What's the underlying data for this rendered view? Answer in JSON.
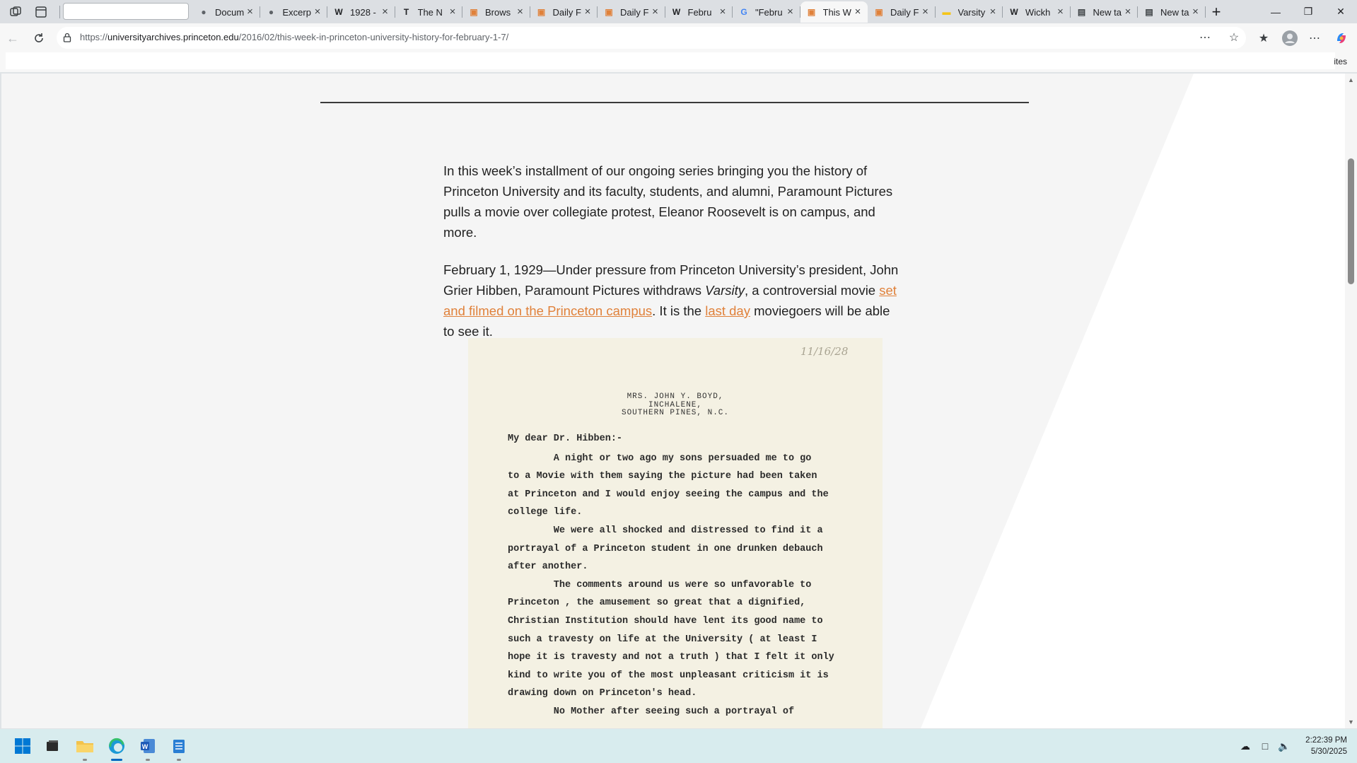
{
  "browser": {
    "tabs": [
      {
        "label": "Docum",
        "icon": "website-icon"
      },
      {
        "label": "Excerp",
        "icon": "website-icon"
      },
      {
        "label": "1928 -",
        "icon": "wikipedia-icon"
      },
      {
        "label": "The N",
        "icon": "nyt-icon"
      },
      {
        "label": "Brows",
        "icon": "blog-icon"
      },
      {
        "label": "Daily F",
        "icon": "blog-icon"
      },
      {
        "label": "Daily F",
        "icon": "blog-icon"
      },
      {
        "label": "Febru",
        "icon": "wikipedia-icon"
      },
      {
        "label": "\"Febru",
        "icon": "google-icon"
      },
      {
        "label": "This W",
        "icon": "blog-icon",
        "active": true
      },
      {
        "label": "Daily F",
        "icon": "blog-icon"
      },
      {
        "label": "Varsity",
        "icon": "imdb-icon"
      },
      {
        "label": "Wickh",
        "icon": "wikipedia-icon"
      },
      {
        "label": "New ta",
        "icon": "newtab-icon"
      },
      {
        "label": "New ta",
        "icon": "newtab-icon"
      }
    ],
    "url_domain": "universityarchives.princeton.edu",
    "url_path": "/2016/02/this-week-in-princeton-university-history-for-february-1-7/",
    "scheme": "https://",
    "favorites_label": "ites",
    "accent_color": "#0067c0"
  },
  "article": {
    "intro": "In this week’s installment of our ongoing series bringing you the history of Princeton University and its faculty, students, and alumni, Paramount Pictures pulls a movie over collegiate protest, Eleanor Roosevelt is on campus, and more.",
    "p2_part1": "February 1, 1929—Under pressure from Princeton University’s president, John Grier Hibben, Paramount Pictures withdraws ",
    "p2_italic": "Varsity",
    "p2_part2": ", a controversial movie ",
    "link1": "set and filmed on the Princeton campus",
    "p2_part3": ". It is the ",
    "link2": "last day",
    "p2_part4": " moviegoers will be able to see it.",
    "link_color": "#e0813a"
  },
  "letter": {
    "handwritten": "11/16/28",
    "letterhead": [
      "MRS. JOHN Y. BOYD,",
      "INCHALENE,",
      "SOUTHERN PINES, N.C."
    ],
    "lines": [
      "My dear Dr. Hibben:-",
      "        A night or two ago my sons persuaded me to go",
      "to a Movie with them saying the picture had been taken",
      "at Princeton and I would enjoy seeing the campus and the",
      "college life.",
      "        We were all shocked and distressed to find it a",
      "portrayal of a Princeton student in one drunken debauch",
      "after another.",
      "        The comments around us were so unfavorable to",
      "Princeton , the amusement so great that a dignified,",
      "Christian Institution should have lent its good name to",
      "such a travesty on life at the University ( at least I",
      "hope it is travesty and not a truth ) that I felt it only",
      "kind to write you of the most unpleasant criticism it is",
      "drawing down on Princeton's head.",
      "        No Mother after seeing such a portrayal of"
    ]
  },
  "taskbar": {
    "apps": [
      "start-icon",
      "task-view-icon",
      "file-explorer-icon",
      "edge-icon",
      "word-icon",
      "notepad-icon"
    ],
    "time": "2:22:39 PM",
    "date": "5/30/2025"
  }
}
